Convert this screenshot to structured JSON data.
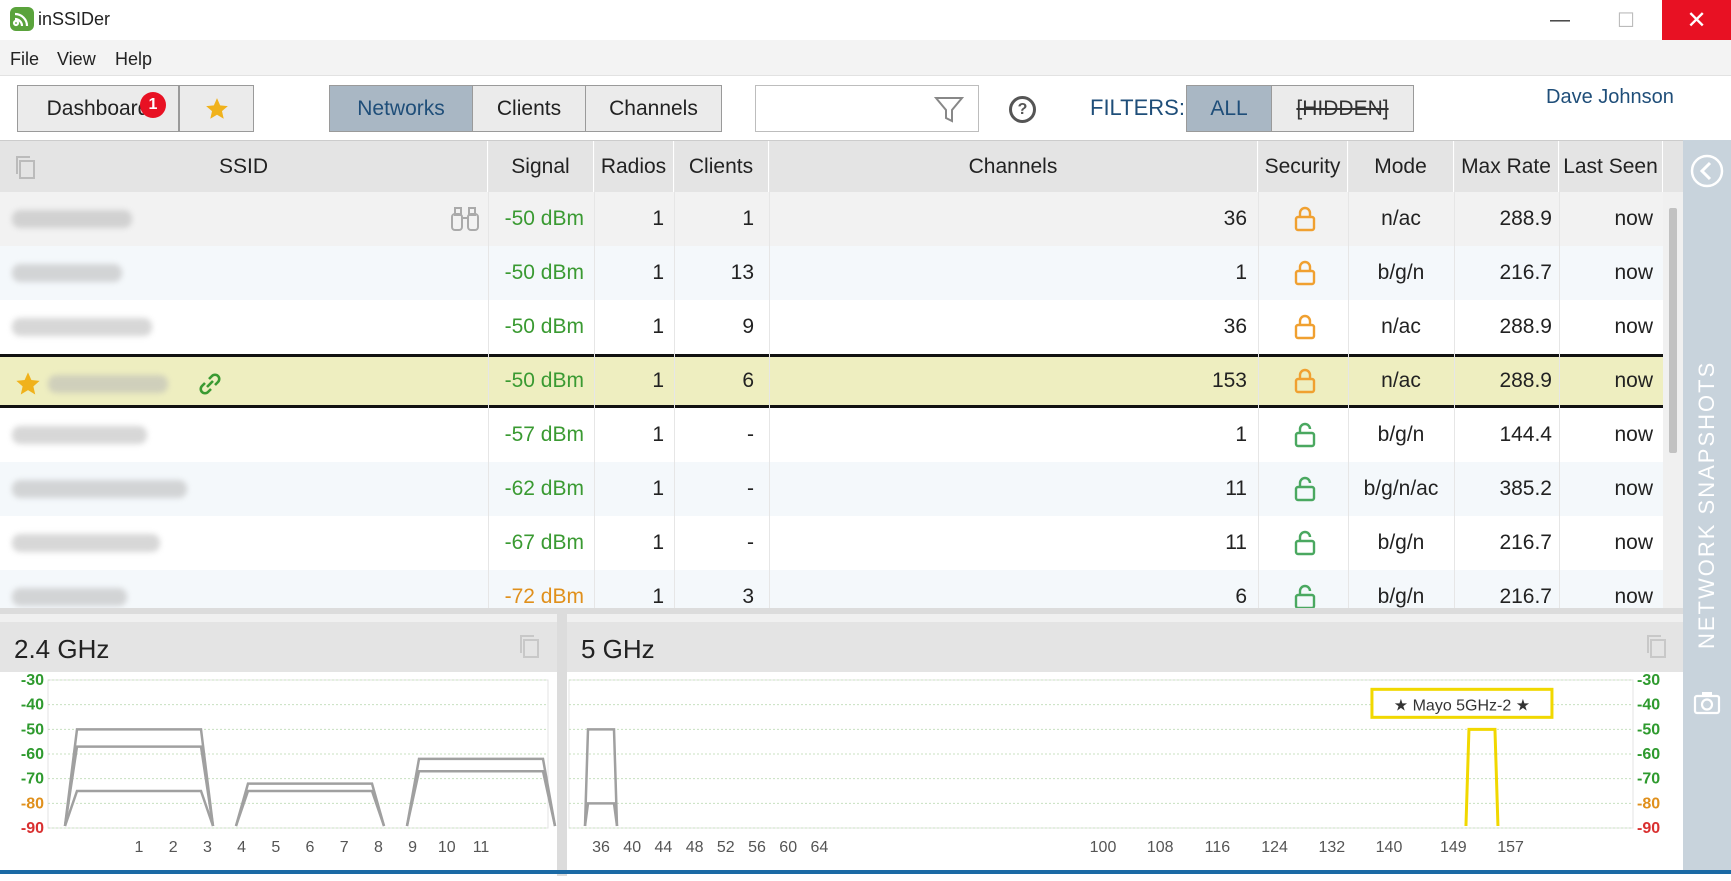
{
  "window": {
    "title": "inSSIDer",
    "controls": {
      "minimize": "—",
      "maximize": "☐",
      "close": "✕"
    }
  },
  "menu": {
    "items": [
      "File",
      "View",
      "Help"
    ]
  },
  "toolbar": {
    "dashboard_label": "Dashboard",
    "dashboard_badge": "1",
    "favorites_icon": "star-icon",
    "tabs": [
      "Networks",
      "Clients",
      "Channels"
    ],
    "active_tab": "Networks",
    "search": {
      "value": "",
      "placeholder": ""
    },
    "help_label": "?",
    "filters_label": "FILTERS:",
    "filter_all": "ALL",
    "filter_hidden": "[HIDDEN]",
    "user_name": "Dave Johnson"
  },
  "table": {
    "headers": [
      "SSID",
      "Signal",
      "Radios",
      "Clients",
      "Channels",
      "Security",
      "Mode",
      "Max Rate",
      "Last Seen"
    ],
    "rows": [
      {
        "ssid": "",
        "signal": "-50 dBm",
        "signal_level": "good",
        "radios": "1",
        "clients": "1",
        "channels": "36",
        "security": "lock-closed-icon",
        "mode": "n/ac",
        "max_rate": "288.9",
        "last_seen": "now",
        "selected": false,
        "favorite": false
      },
      {
        "ssid": "",
        "signal": "-50 dBm",
        "signal_level": "good",
        "radios": "1",
        "clients": "13",
        "channels": "1",
        "security": "lock-closed-icon",
        "mode": "b/g/n",
        "max_rate": "216.7",
        "last_seen": "now",
        "selected": false,
        "favorite": false
      },
      {
        "ssid": "",
        "signal": "-50 dBm",
        "signal_level": "good",
        "radios": "1",
        "clients": "9",
        "channels": "36",
        "security": "lock-closed-icon",
        "mode": "n/ac",
        "max_rate": "288.9",
        "last_seen": "now",
        "selected": false,
        "favorite": false
      },
      {
        "ssid": "",
        "signal": "-50 dBm",
        "signal_level": "good",
        "radios": "1",
        "clients": "6",
        "channels": "153",
        "security": "lock-closed-icon",
        "mode": "n/ac",
        "max_rate": "288.9",
        "last_seen": "now",
        "selected": true,
        "favorite": true
      },
      {
        "ssid": "",
        "signal": "-57 dBm",
        "signal_level": "good",
        "radios": "1",
        "clients": "-",
        "channels": "1",
        "security": "lock-open-icon",
        "mode": "b/g/n",
        "max_rate": "144.4",
        "last_seen": "now",
        "selected": false,
        "favorite": false
      },
      {
        "ssid": "",
        "signal": "-62 dBm",
        "signal_level": "good",
        "radios": "1",
        "clients": "-",
        "channels": "11",
        "security": "lock-open-icon",
        "mode": "b/g/n/ac",
        "max_rate": "385.2",
        "last_seen": "now",
        "selected": false,
        "favorite": false
      },
      {
        "ssid": "",
        "signal": "-67 dBm",
        "signal_level": "good",
        "radios": "1",
        "clients": "-",
        "channels": "11",
        "security": "lock-open-icon",
        "mode": "b/g/n",
        "max_rate": "216.7",
        "last_seen": "now",
        "selected": false,
        "favorite": false
      },
      {
        "ssid": "",
        "signal": "-72 dBm",
        "signal_level": "fair",
        "radios": "1",
        "clients": "3",
        "channels": "6",
        "security": "lock-open-icon",
        "mode": "b/g/n",
        "max_rate": "216.7",
        "last_seen": "now",
        "selected": false,
        "favorite": false
      }
    ]
  },
  "side_panel": {
    "label": "NETWORK SNAPSHOTS"
  },
  "colors": {
    "accent": "#1f4e79",
    "good": "#3a9a32",
    "fair": "#e0901c",
    "selected_row": "#eeeec0",
    "lock_secure": "#f0a030",
    "lock_open": "#4aa860",
    "highlight": "#f1d800"
  },
  "chart_data": [
    {
      "type": "area",
      "title": "2.4 GHz",
      "x_ticks": [
        "1",
        "2",
        "3",
        "4",
        "5",
        "6",
        "7",
        "8",
        "9",
        "10",
        "11"
      ],
      "y_ticks": [
        "-30",
        "-40",
        "-50",
        "-60",
        "-70",
        "-80",
        "-90"
      ],
      "ylim": [
        -90,
        -30
      ],
      "series": [
        {
          "channel": 1,
          "dbm": -50
        },
        {
          "channel": 1,
          "dbm": -57
        },
        {
          "channel": 1,
          "dbm": -75
        },
        {
          "channel": 6,
          "dbm": -72
        },
        {
          "channel": 6,
          "dbm": -75
        },
        {
          "channel": 11,
          "dbm": -62
        },
        {
          "channel": 11,
          "dbm": -67
        }
      ]
    },
    {
      "type": "area",
      "title": "5 GHz",
      "x_ticks": [
        "36",
        "40",
        "44",
        "48",
        "52",
        "56",
        "60",
        "64",
        "100",
        "108",
        "116",
        "124",
        "132",
        "140",
        "149",
        "157"
      ],
      "y_ticks": [
        "-30",
        "-40",
        "-50",
        "-60",
        "-70",
        "-80",
        "-90"
      ],
      "ylim": [
        -90,
        -30
      ],
      "series": [
        {
          "channel": 36,
          "dbm": -50
        },
        {
          "channel": 36,
          "dbm": -80
        },
        {
          "channel": 153,
          "dbm": -50,
          "highlight": true,
          "label": "★ Mayo 5GHz-2 ★"
        }
      ]
    }
  ]
}
